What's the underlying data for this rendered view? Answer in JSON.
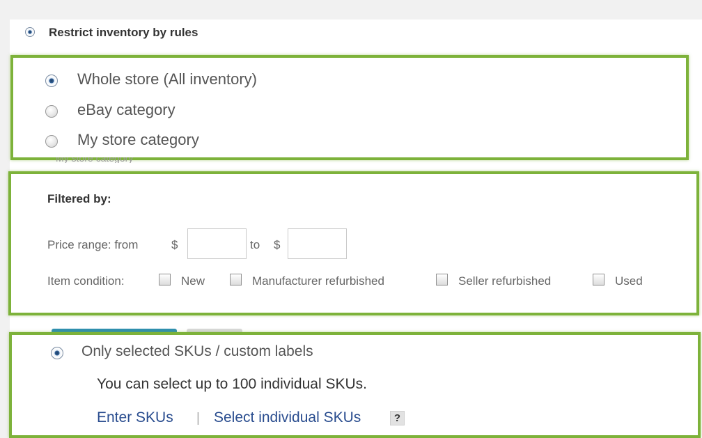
{
  "restrict": {
    "label": "Restrict inventory by rules",
    "selected": true
  },
  "inventory_scope": {
    "options": [
      {
        "label": "Whole store (All inventory)",
        "selected": true
      },
      {
        "label": "eBay category",
        "selected": false
      },
      {
        "label": "My store category",
        "selected": false
      }
    ]
  },
  "filter": {
    "title": "Filtered by:",
    "price_label": "Price range: from",
    "currency": "$",
    "to_label": "to",
    "price_from": "",
    "price_to": "",
    "condition_label": "Item condition:",
    "conditions": [
      {
        "label": "New",
        "checked": false
      },
      {
        "label": "Manufacturer refurbished",
        "checked": false
      },
      {
        "label": "Seller refurbished",
        "checked": false
      },
      {
        "label": "Used",
        "checked": false
      }
    ]
  },
  "sku": {
    "option_label": "Only selected SKUs / custom labels",
    "selected": true,
    "description": "You can select up to 100 individual SKUs.",
    "enter_link": "Enter SKUs",
    "separator": "|",
    "select_link": "Select individual SKUs",
    "help": "?"
  },
  "colors": {
    "highlight_border": "#7db23a",
    "link": "#2a4d8f"
  }
}
